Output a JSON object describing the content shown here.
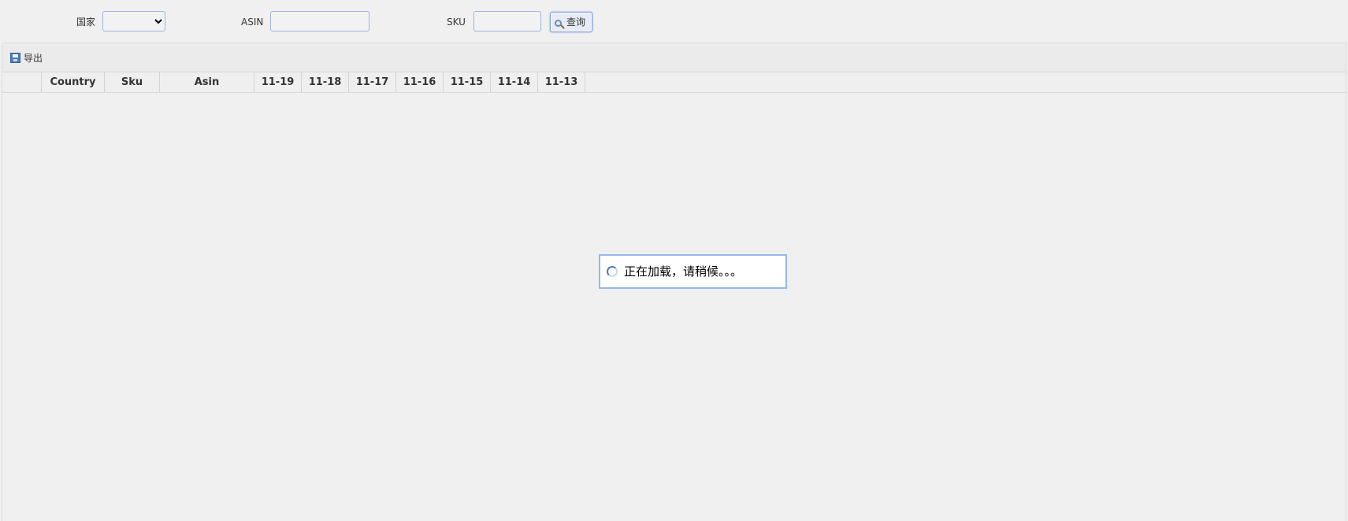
{
  "filters": {
    "country_label": "国家",
    "country_selected": "",
    "asin_label": "ASIN",
    "asin_value": "",
    "sku_label": "SKU",
    "sku_value": "",
    "search_label": "查询"
  },
  "toolbar": {
    "export_label": "导出"
  },
  "table": {
    "columns": [
      "",
      "Country",
      "Sku",
      "Asin",
      "11-19",
      "11-18",
      "11-17",
      "11-16",
      "11-15",
      "11-14",
      "11-13"
    ],
    "rows": []
  },
  "loading": {
    "message": "正在加载，请稍候。。。"
  },
  "colors": {
    "accent_border": "#95b8e7",
    "background": "#f0f0f0"
  }
}
